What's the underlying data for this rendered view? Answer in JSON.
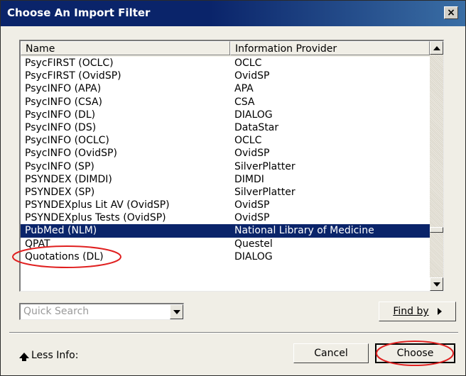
{
  "window": {
    "title": "Choose An Import Filter",
    "close_glyph": "×"
  },
  "list": {
    "columns": {
      "name": "Name",
      "provider": "Information Provider"
    },
    "rows": [
      {
        "name": "PsycFIRST (OCLC)",
        "provider": "OCLC"
      },
      {
        "name": "PsycFIRST (OvidSP)",
        "provider": "OvidSP"
      },
      {
        "name": "PsycINFO (APA)",
        "provider": "APA"
      },
      {
        "name": "PsycINFO (CSA)",
        "provider": "CSA"
      },
      {
        "name": "PsycINFO (DL)",
        "provider": "DIALOG"
      },
      {
        "name": "PsycINFO (DS)",
        "provider": "DataStar"
      },
      {
        "name": "PsycINFO (OCLC)",
        "provider": "OCLC"
      },
      {
        "name": "PsycINFO (OvidSP)",
        "provider": "OvidSP"
      },
      {
        "name": "PsycINFO (SP)",
        "provider": "SilverPlatter"
      },
      {
        "name": "PSYNDEX (DIMDI)",
        "provider": "DIMDI"
      },
      {
        "name": "PSYNDEX (SP)",
        "provider": "SilverPlatter"
      },
      {
        "name": "PSYNDEXplus Lit AV (OvidSP)",
        "provider": "OvidSP"
      },
      {
        "name": "PSYNDEXplus Tests (OvidSP)",
        "provider": "OvidSP"
      },
      {
        "name": "PubMed (NLM)",
        "provider": "National Library of Medicine",
        "selected": true
      },
      {
        "name": "QPAT",
        "provider": "Questel"
      },
      {
        "name": "Quotations (DL)",
        "provider": "DIALOG"
      }
    ],
    "selected_index": 13
  },
  "search": {
    "placeholder": "Quick Search"
  },
  "buttons": {
    "find_by": "Find by",
    "cancel": "Cancel",
    "choose": "Choose",
    "less_info": "Less Info:"
  },
  "colors": {
    "title_bar": "#0a246a",
    "selection": "#0a246a",
    "annotation": "#e02020"
  }
}
